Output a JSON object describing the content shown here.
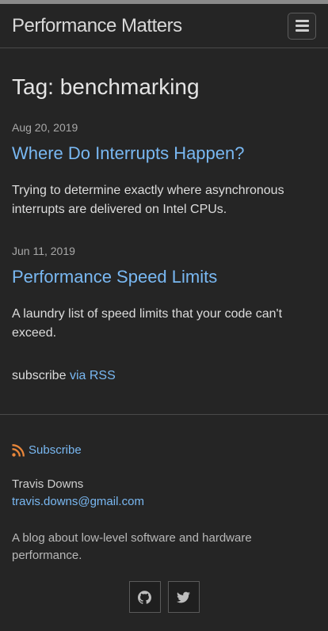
{
  "header": {
    "site_title": "Performance Matters"
  },
  "page": {
    "heading": "Tag: benchmarking"
  },
  "posts": [
    {
      "date": "Aug 20, 2019",
      "title": "Where Do Interrupts Happen?",
      "excerpt": "Trying to determine exactly where asynchronous interrupts are delivered on Intel CPUs."
    },
    {
      "date": "Jun 11, 2019",
      "title": "Performance Speed Limits",
      "excerpt": "A laundry list of speed limits that your code can't exceed."
    }
  ],
  "subscribe": {
    "prefix": "subscribe",
    "link": "via RSS"
  },
  "footer": {
    "subscribe_label": "Subscribe",
    "author": "Travis Downs",
    "email": "travis.downs@gmail.com",
    "description": "A blog about low-level software and hardware performance.",
    "social_icons": [
      "github-icon",
      "twitter-icon"
    ]
  },
  "colors": {
    "background": "#252525",
    "link": "#79b8f2",
    "text": "#e0e0e0"
  }
}
